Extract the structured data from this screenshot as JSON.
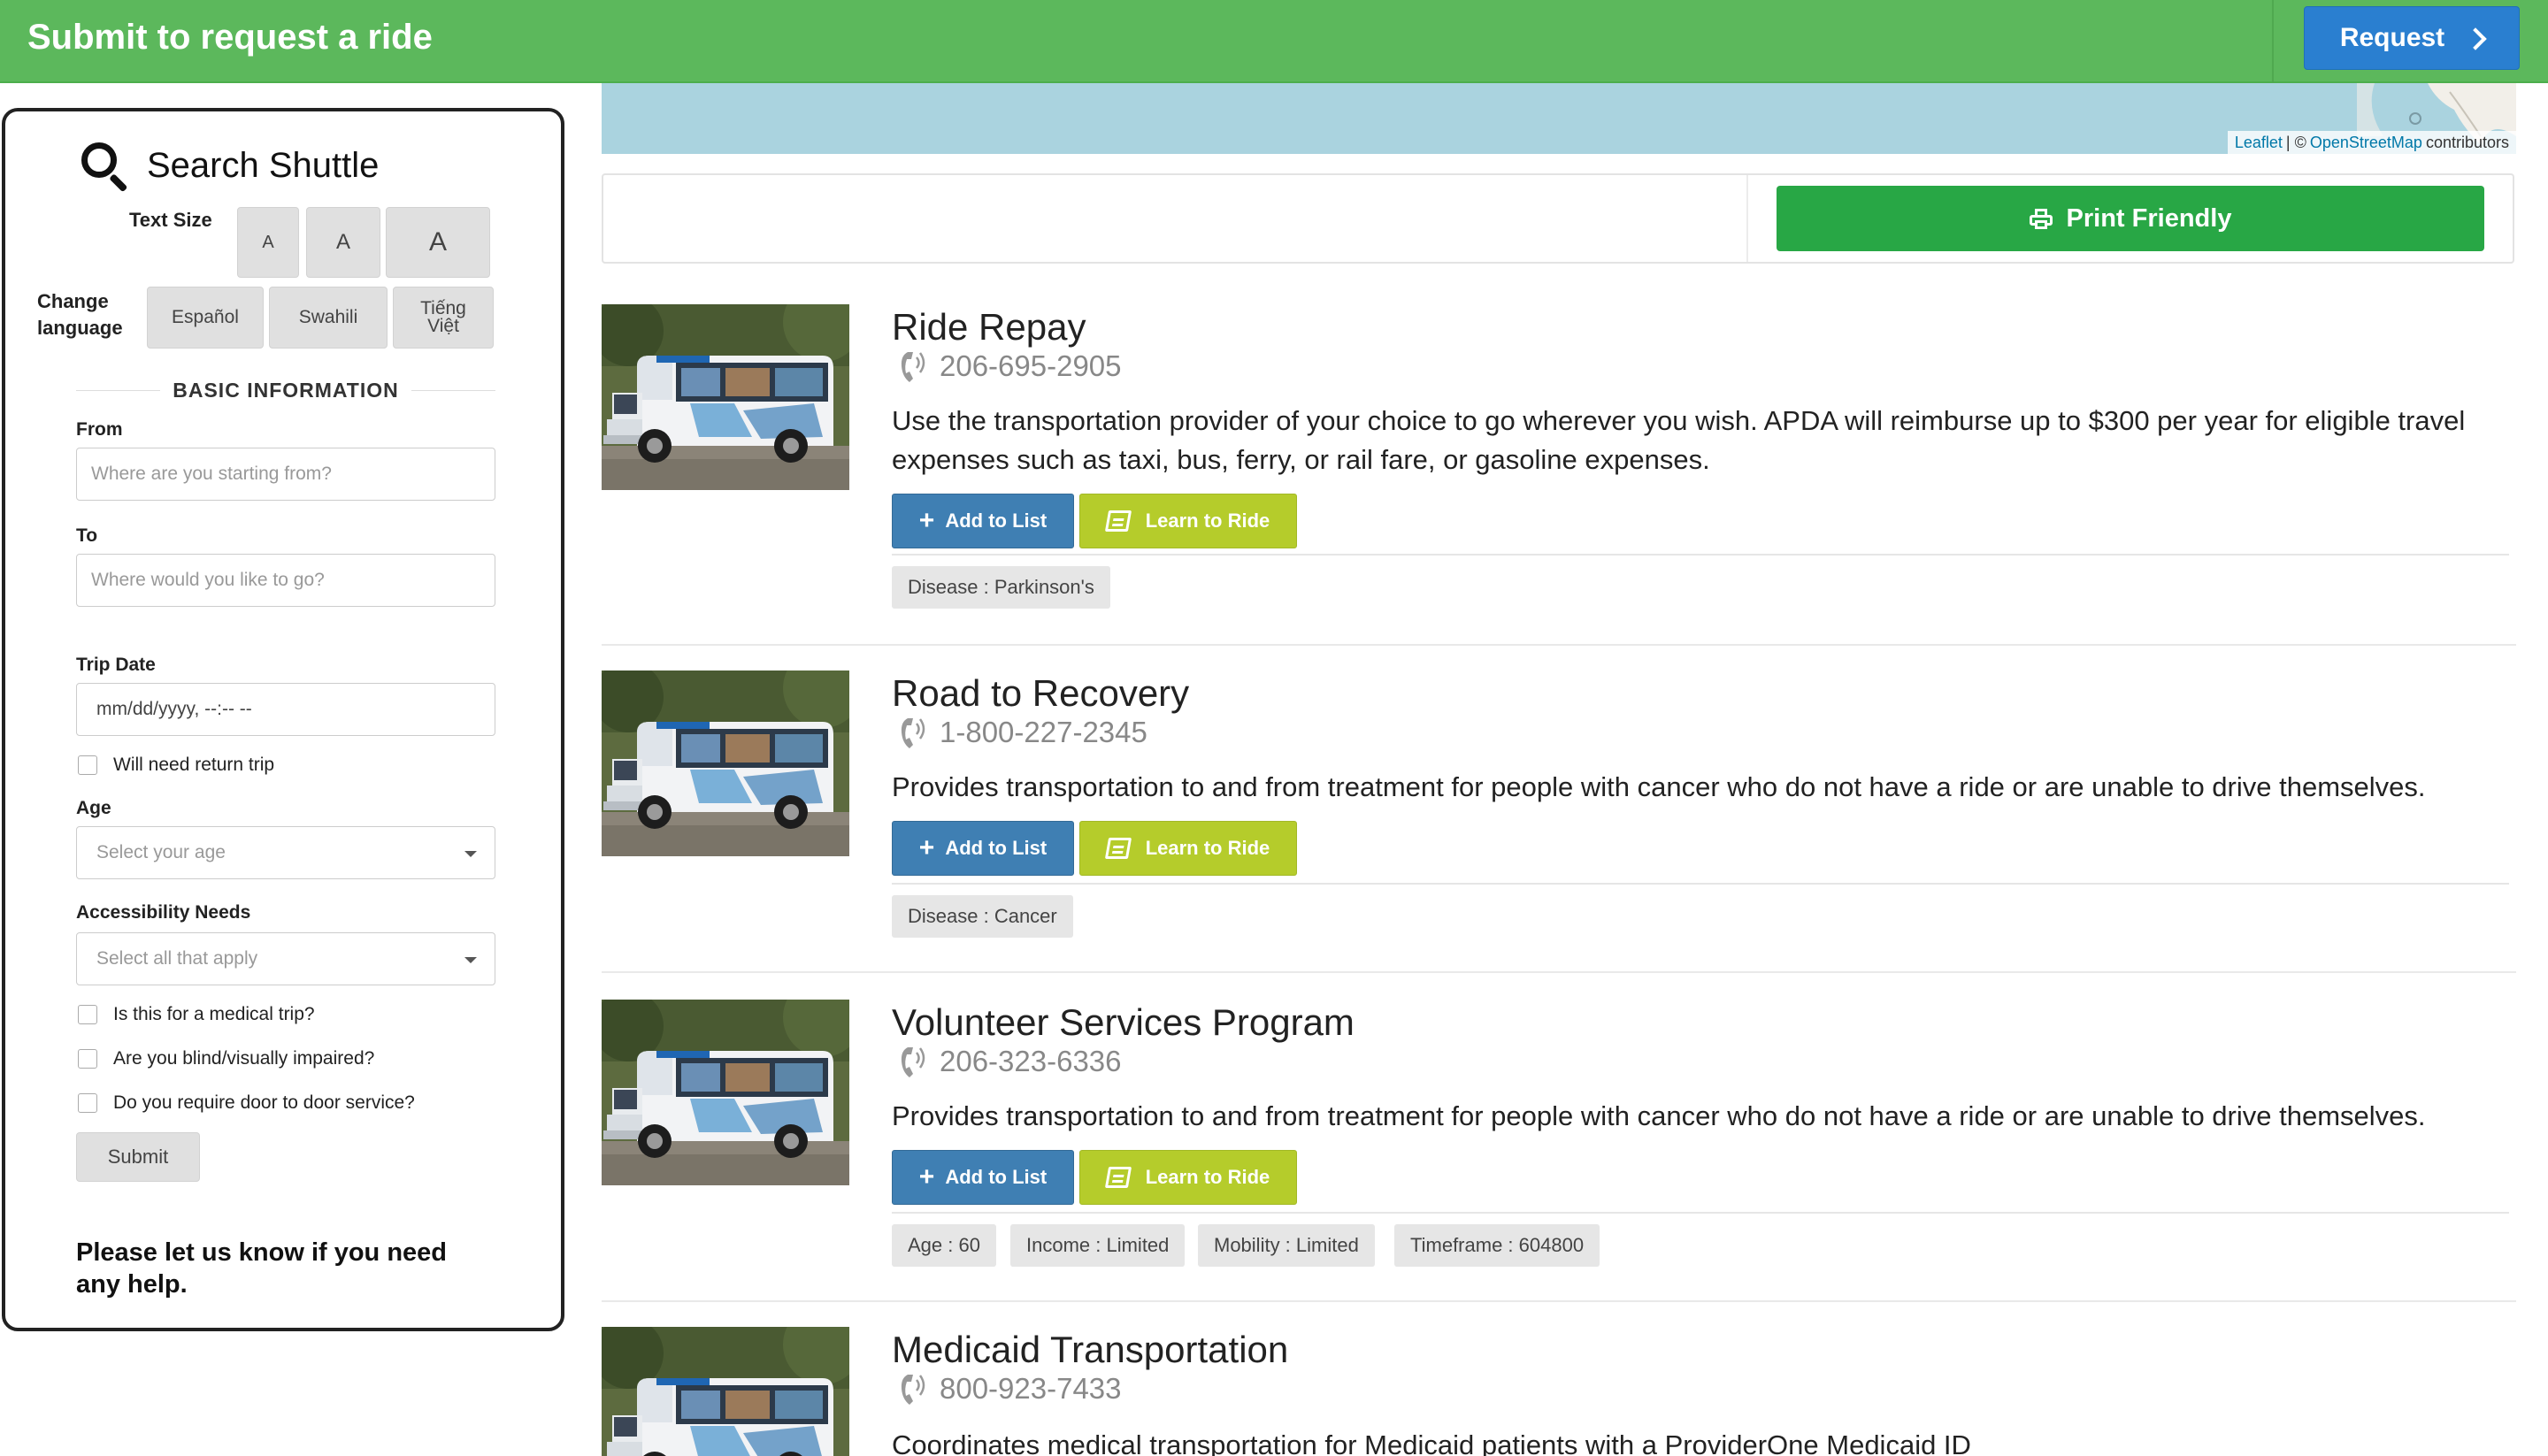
{
  "header": {
    "title": "Submit to request a ride",
    "request_label": "Request"
  },
  "sidebar": {
    "title": "Search Shuttle",
    "text_size_label": "Text Size",
    "text_size_options": [
      "A",
      "A",
      "A"
    ],
    "language_label": "Change language",
    "languages": [
      "Español",
      "Swahili",
      "Tiếng Việt"
    ],
    "section_heading": "BASIC INFORMATION",
    "from_label": "From",
    "from_placeholder": "Where are you starting from?",
    "to_label": "To",
    "to_placeholder": "Where would you like to go?",
    "trip_date_label": "Trip Date",
    "trip_date_value": "mm/dd/yyyy, --:-- --",
    "return_trip_label": "Will need return trip",
    "age_label": "Age",
    "age_placeholder": "Select your age",
    "accessibility_label": "Accessibility Needs",
    "accessibility_placeholder": "Select all that apply",
    "checks": [
      "Is this for a medical trip?",
      "Are you blind/visually impaired?",
      "Do you require door to door service?"
    ],
    "submit_label": "Submit",
    "help_text": "Please let us know if you need any help."
  },
  "map": {
    "attribution_link1": "Leaflet",
    "attribution_sep": "| ©",
    "attribution_link2": "OpenStreetMap",
    "attribution_suffix": "contributors"
  },
  "toolbar": {
    "print_label": "Print Friendly"
  },
  "listing_buttons": {
    "add": "Add to List",
    "learn": "Learn to Ride"
  },
  "listings": [
    {
      "name": "Ride Repay",
      "phone": "206-695-2905",
      "description": "Use the transportation provider of your choice to go wherever you wish. APDA will reimburse up to $300 per year for eligible travel expenses such as taxi, bus, ferry, or rail fare, or gasoline expenses.",
      "tags": [
        "Disease : Parkinson's"
      ]
    },
    {
      "name": "Road to Recovery",
      "phone": "1-800-227-2345",
      "description": "Provides transportation to and from treatment for people with cancer who do not have a ride or are unable to drive themselves.",
      "tags": [
        "Disease : Cancer"
      ]
    },
    {
      "name": "Volunteer Services Program",
      "phone": "206-323-6336",
      "description": "Provides transportation to and from treatment for people with cancer who do not have a ride or are unable to drive themselves.",
      "tags": [
        "Age : 60",
        "Income : Limited",
        "Mobility : Limited",
        "Timeframe : 604800"
      ]
    },
    {
      "name": "Medicaid Transportation",
      "phone": "800-923-7433",
      "description": "Coordinates medical transportation for Medicaid patients with a ProviderOne Medicaid ID",
      "tags": []
    }
  ],
  "colors": {
    "header_green": "#5cb85c",
    "request_blue": "#2a7fd0",
    "print_green": "#28a745",
    "add_blue": "#3f7fb3",
    "learn_olive": "#b5cc2b",
    "map_water": "#aad3df"
  },
  "icons": {
    "search": "search-icon",
    "chevron": "chevron-right-icon",
    "printer": "printer-icon",
    "phone": "phone-icon",
    "plus": "plus-icon",
    "book": "book-icon"
  }
}
